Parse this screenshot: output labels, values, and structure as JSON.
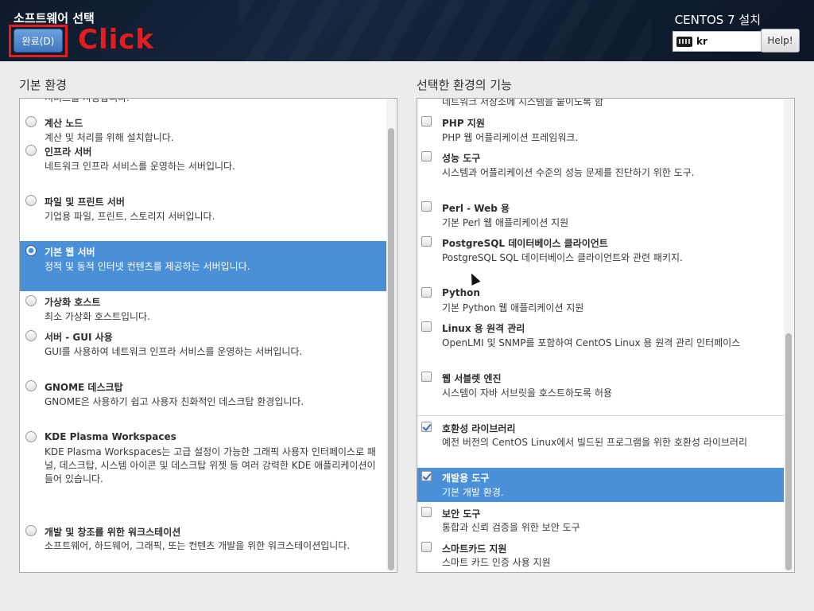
{
  "header": {
    "title": "소프트웨어 선택",
    "done_button": "완료(D)",
    "annotation": "Click",
    "install_title": "CENTOS 7 설치",
    "keyboard_layout": "kr",
    "help_button": "Help!"
  },
  "base_env": {
    "title": "기본 환경",
    "clipped_text": "서비스를 사용합니다.",
    "items": [
      {
        "name": "계산 노드",
        "desc": "계산 및 처리를 위해 설치합니다.",
        "selected": false
      },
      {
        "name": "인프라 서버",
        "desc": "네트워크 인프라 서비스를 운영하는 서버입니다.",
        "selected": false
      },
      {
        "name": "파일 및 프린트 서버",
        "desc": "기업용 파일, 프린트, 스토리지 서버입니다.",
        "selected": false
      },
      {
        "name": "기본 웹 서버",
        "desc": "정적 및 동적 인터넷 컨텐츠를 제공하는 서버입니다.",
        "selected": true
      },
      {
        "name": "가상화 호스트",
        "desc": "최소 가상화 호스트입니다.",
        "selected": false
      },
      {
        "name": "서버 - GUI 사용",
        "desc": "GUI를 사용하여 네트워크 인프라 서비스를 운영하는 서버입니다.",
        "selected": false
      },
      {
        "name": "GNOME 데스크탑",
        "desc": "GNOME은 사용하기 쉽고 사용자 친화적인 데스크탑 환경입니다.",
        "selected": false
      },
      {
        "name": "KDE Plasma Workspaces",
        "desc": "KDE Plasma Workspaces는 고급 설정이 가능한 그래픽 사용자 인터페이스로 패널, 데스크탑, 시스템 아이콘 및 데스크탑 위젯 등 여러 강력한 KDE 애플리케이션이 들어 있습니다.",
        "selected": false
      },
      {
        "name": "개발 및 창조를 위한 워크스테이션",
        "desc": "소프트웨어, 하드웨어, 그래픽, 또는 컨텐츠 개발을 위한 워크스테이션입니다.",
        "selected": false
      }
    ]
  },
  "addons": {
    "title": "선택한 환경의 기능",
    "clipped_text": "네트워크 저장소에 시스템을 붙이도록 함",
    "items": [
      {
        "name": "PHP 지원",
        "desc": "PHP 웹 어플리케이션 프레임워크.",
        "checked": false,
        "selected": false
      },
      {
        "name": "성능 도구",
        "desc": "시스템과 어플리케이션 수준의 성능 문제를 진단하기 위한 도구.",
        "checked": false,
        "selected": false
      },
      {
        "name": "Perl - Web 용",
        "desc": "기본 Perl 웹 애플리케이션 지원",
        "checked": false,
        "selected": false
      },
      {
        "name": "PostgreSQL 데이터베이스 클라이언트",
        "desc": "PostgreSQL SQL 데이터베이스 클라이언트와 관련 패키지.",
        "checked": false,
        "selected": false
      },
      {
        "name": "Python",
        "desc": "기본 Python 웹 애플리케이션 지원",
        "checked": false,
        "selected": false
      },
      {
        "name": "Linux 용 원격 관리",
        "desc": "OpenLMI 및 SNMP를 포함하여 CentOS Linux 용 원격 관리 인터페이스",
        "checked": false,
        "selected": false
      },
      {
        "name": "웹 서블렛 엔진",
        "desc": "시스템이 자바 서브릿을 호스트하도록 허용",
        "checked": false,
        "selected": false
      },
      {
        "name": "호환성 라이브러리",
        "desc": "예전 버전의 CentOS Linux에서 빌드된 프로그램을 위한 호환성 라이브러리",
        "checked": true,
        "selected": false
      },
      {
        "name": "개발용 도구",
        "desc": "기본 개발 환경.",
        "checked": true,
        "selected": true
      },
      {
        "name": "보안 도구",
        "desc": "통합과 신뢰 검증을 위한 보안 도구",
        "checked": false,
        "selected": false
      },
      {
        "name": "스마트카드 지원",
        "desc": "스마트 카드 인증 사용 지원",
        "checked": false,
        "selected": false
      }
    ]
  }
}
